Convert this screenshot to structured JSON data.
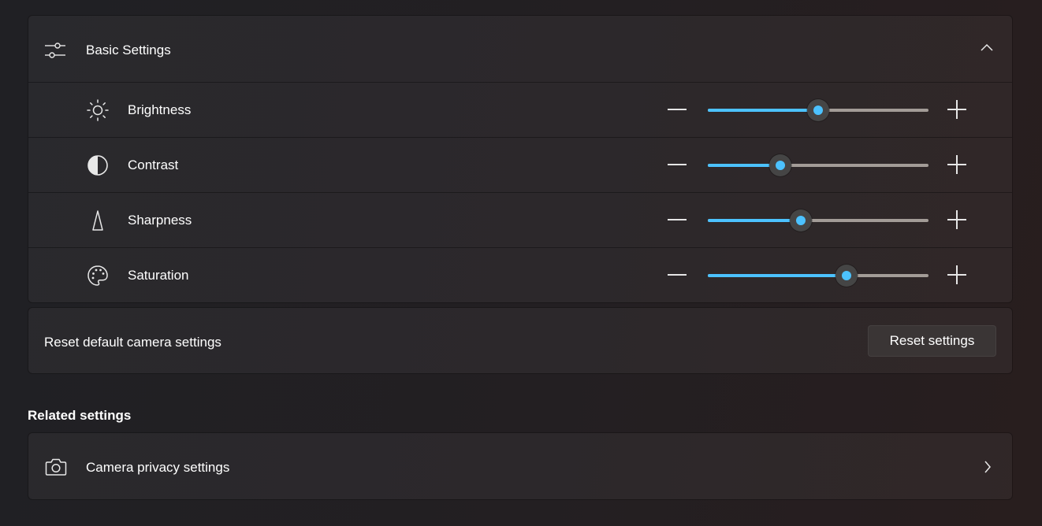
{
  "basic_settings": {
    "title": "Basic Settings",
    "icon": "sliders-icon",
    "expanded": true,
    "rows": [
      {
        "label": "Brightness",
        "icon": "sun-icon",
        "value": 0.5,
        "accent": "#4cc2ff"
      },
      {
        "label": "Contrast",
        "icon": "contrast-icon",
        "value": 0.33,
        "accent": "#4cc2ff"
      },
      {
        "label": "Sharpness",
        "icon": "triangle-icon",
        "value": 0.42,
        "accent": "#4cc2ff"
      },
      {
        "label": "Saturation",
        "icon": "palette-icon",
        "value": 0.63,
        "accent": "#4cc2ff"
      }
    ]
  },
  "reset": {
    "label": "Reset default camera settings",
    "button_label": "Reset settings"
  },
  "related": {
    "heading": "Related settings",
    "items": [
      {
        "label": "Camera privacy settings",
        "icon": "camera-icon"
      }
    ]
  },
  "colors": {
    "accent": "#4cc2ff",
    "track": "#a39c97",
    "thumb": "#454545"
  }
}
